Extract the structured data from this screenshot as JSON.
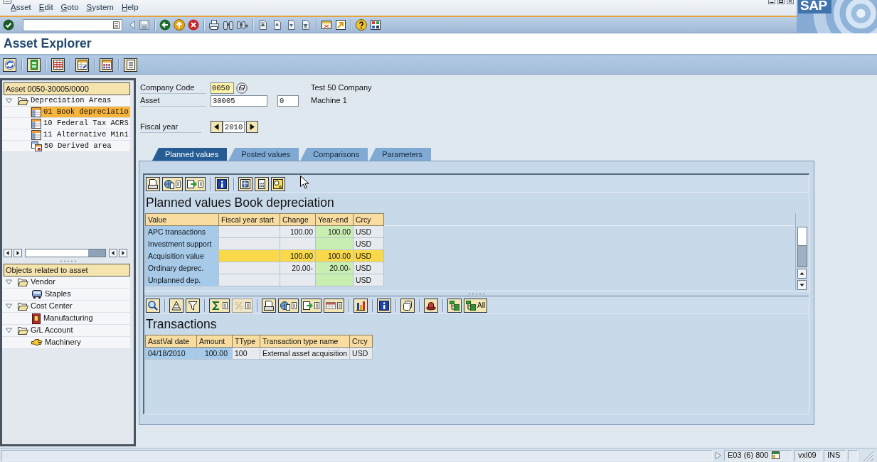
{
  "menu": [
    {
      "label": "Asset"
    },
    {
      "label": "Edit"
    },
    {
      "label": "Goto"
    },
    {
      "label": "System"
    },
    {
      "label": "Help"
    }
  ],
  "logo": {
    "text": "SAP"
  },
  "window": {
    "title": "Asset Explorer"
  },
  "asset_tree": {
    "header": "Asset 0050-30005/0000",
    "items": [
      {
        "label": "Depreciation Areas",
        "kind": "folder",
        "expanded": true,
        "selected": false,
        "children": [
          {
            "label": "01 Book depreciatio",
            "kind": "area",
            "selected": true
          },
          {
            "label": "10 Federal Tax ACRS",
            "kind": "area",
            "selected": false
          },
          {
            "label": "11 Alternative Mini",
            "kind": "area",
            "selected": false
          },
          {
            "label": "50 Derived area",
            "kind": "derived_area",
            "selected": false
          }
        ]
      }
    ]
  },
  "related_objects": {
    "header": "Objects related to asset",
    "items": [
      {
        "label": "Vendor",
        "kind": "folder",
        "expanded": true,
        "selected": false,
        "children": [
          {
            "label": "Staples",
            "kind": "vendor",
            "selected": false
          }
        ]
      },
      {
        "label": "Cost Center",
        "kind": "folder",
        "expanded": true,
        "selected": false,
        "children": [
          {
            "label": "Manufacturing",
            "kind": "cost_center",
            "selected": false
          }
        ]
      },
      {
        "label": "G/L Account",
        "kind": "folder",
        "expanded": true,
        "selected": false,
        "children": [
          {
            "label": "Machinery",
            "kind": "account",
            "selected": false
          }
        ]
      }
    ]
  },
  "fields": {
    "company_code": {
      "label": "Company Code",
      "value": "0050",
      "description": "Test 50 Company"
    },
    "asset": {
      "label": "Asset",
      "value": "30005",
      "subnumber": "0",
      "description": "Machine 1"
    },
    "fiscal_year": {
      "label": "Fiscal year",
      "value": "2010"
    }
  },
  "tabs": [
    {
      "label": "Planned values",
      "selected": true
    },
    {
      "label": "Posted values",
      "selected": false
    },
    {
      "label": "Comparisons",
      "selected": false
    },
    {
      "label": "Parameters",
      "selected": false
    }
  ],
  "planned_values": {
    "title": "Planned values Book depreciation",
    "columns": [
      {
        "label": "Value",
        "kind": "key"
      },
      {
        "label": "Fiscal year start",
        "kind": "amount"
      },
      {
        "label": "Change",
        "kind": "amount"
      },
      {
        "label": "Year-end",
        "kind": "total"
      },
      {
        "label": "Crcy",
        "kind": "text"
      }
    ],
    "rows": [
      {
        "cells": [
          "APC transactions",
          null,
          "100.00",
          "100.00",
          "USD"
        ],
        "highlighted": false
      },
      {
        "cells": [
          "Investment support",
          null,
          null,
          null,
          "USD"
        ],
        "highlighted": false
      },
      {
        "cells": [
          "Acquisition value",
          null,
          "100.00",
          "100.00",
          "USD"
        ],
        "highlighted": true
      },
      {
        "cells": [
          "Ordinary deprec.",
          null,
          "20.00-",
          "20.00-",
          "USD"
        ],
        "highlighted": false
      },
      {
        "cells": [
          "Unplanned dep.",
          null,
          null,
          null,
          "USD"
        ],
        "highlighted": false
      }
    ]
  },
  "transactions": {
    "title": "Transactions",
    "toolbar_button_label": "All",
    "columns": [
      {
        "label": "AsstVal date",
        "kind": "key"
      },
      {
        "label": "Amount",
        "kind": "key_amount"
      },
      {
        "label": "TType",
        "kind": "text"
      },
      {
        "label": "Transaction type name",
        "kind": "text"
      },
      {
        "label": "Crcy",
        "kind": "text"
      }
    ],
    "rows": [
      {
        "cells": [
          "04/18/2010",
          "100.00",
          "100",
          "External asset acquisition",
          "USD"
        ],
        "highlighted": false
      }
    ]
  },
  "status_bar": {
    "system": "E03 (6) 800",
    "user": "vxl09",
    "mode": "INS"
  }
}
